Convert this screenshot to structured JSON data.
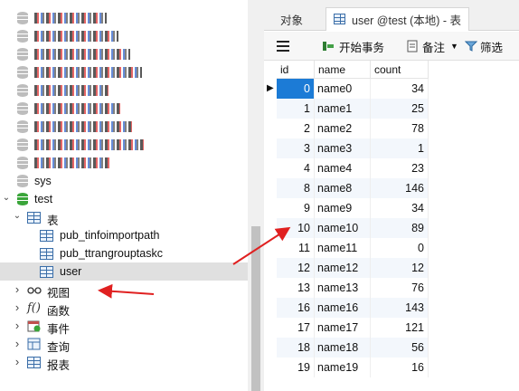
{
  "navigator": {
    "items": [
      {
        "label": "mall_f_mems",
        "kind": "db",
        "redacted": true
      },
      {
        "label": "mall_f_check",
        "kind": "db",
        "redacted": true
      },
      {
        "label": "mall_f_fsys",
        "kind": "db",
        "redacted": true
      },
      {
        "label": "mall_f_warehouse",
        "kind": "db",
        "redacted": true
      },
      {
        "label": "mall_f_pay",
        "kind": "db",
        "redacted": true
      },
      {
        "label": "mall_f_config",
        "kind": "db",
        "redacted": true
      },
      {
        "label": "mall_f_trade",
        "kind": "db",
        "redacted": true
      },
      {
        "label": "mall_f_sms",
        "kind": "db",
        "redacted": true
      },
      {
        "label": "mall_f_item",
        "kind": "db",
        "redacted": true
      },
      {
        "label": "sys",
        "kind": "db"
      },
      {
        "label": "test",
        "kind": "db-open"
      },
      {
        "label": "表",
        "kind": "folder"
      },
      {
        "label": "pub_tinfoimportpath",
        "kind": "table"
      },
      {
        "label": "pub_ttrangrouptaskc",
        "kind": "table"
      },
      {
        "label": "user",
        "kind": "table",
        "selected": true
      },
      {
        "label": "视图",
        "kind": "views"
      },
      {
        "label": "函数",
        "kind": "functions"
      },
      {
        "label": "事件",
        "kind": "events"
      },
      {
        "label": "查询",
        "kind": "queries"
      },
      {
        "label": "报表",
        "kind": "reports"
      }
    ]
  },
  "tabs": {
    "objects": "对象",
    "active": "user @test (本地) - 表"
  },
  "toolbar": {
    "begin_transaction": "开始事务",
    "note": "备注",
    "filter": "筛选"
  },
  "grid": {
    "columns": [
      "id",
      "name",
      "count"
    ],
    "rows": [
      {
        "id": "0",
        "name": "name0",
        "count": "34"
      },
      {
        "id": "1",
        "name": "name1",
        "count": "25"
      },
      {
        "id": "2",
        "name": "name2",
        "count": "78"
      },
      {
        "id": "3",
        "name": "name3",
        "count": "1"
      },
      {
        "id": "4",
        "name": "name4",
        "count": "23"
      },
      {
        "id": "8",
        "name": "name8",
        "count": "146"
      },
      {
        "id": "9",
        "name": "name9",
        "count": "34"
      },
      {
        "id": "10",
        "name": "name10",
        "count": "89"
      },
      {
        "id": "11",
        "name": "name11",
        "count": "0"
      },
      {
        "id": "12",
        "name": "name12",
        "count": "12"
      },
      {
        "id": "13",
        "name": "name13",
        "count": "76"
      },
      {
        "id": "16",
        "name": "name16",
        "count": "143"
      },
      {
        "id": "17",
        "name": "name17",
        "count": "121"
      },
      {
        "id": "18",
        "name": "name18",
        "count": "56"
      },
      {
        "id": "19",
        "name": "name19",
        "count": "16"
      }
    ]
  },
  "colors": {
    "selection": "#1c7bd6",
    "annotation_arrow": "#e02020",
    "db_icon": "#bdbdbd",
    "db_icon_open": "#3aa53a"
  }
}
